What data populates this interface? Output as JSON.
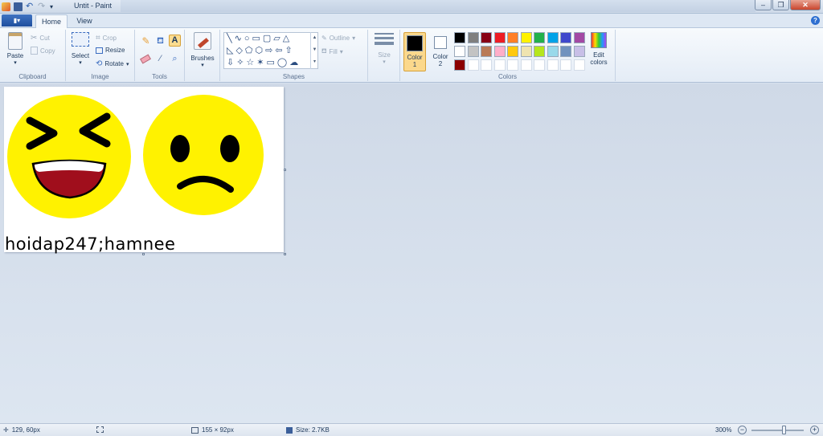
{
  "window": {
    "title": "Untit - Paint"
  },
  "tabs": {
    "file_menu": "▮▾",
    "home": "Home",
    "view": "View"
  },
  "clipboard": {
    "paste": "Paste",
    "cut": "Cut",
    "copy": "Copy",
    "label": "Clipboard"
  },
  "image": {
    "select": "Select",
    "crop": "Crop",
    "resize": "Resize",
    "rotate": "Rotate",
    "label": "Image"
  },
  "tools": {
    "label": "Tools"
  },
  "brushes": {
    "label": "Brushes"
  },
  "shapes": {
    "outline": "Outline",
    "fill": "Fill",
    "label": "Shapes"
  },
  "size": {
    "label": "Size"
  },
  "colors": {
    "color1": "Color\n1",
    "color1_line1": "Color",
    "color1_line2": "1",
    "color2_line1": "Color",
    "color2_line2": "2",
    "edit_line1": "Edit",
    "edit_line2": "colors",
    "label": "Colors",
    "color1_value": "#000000",
    "color2_value": "#ffffff",
    "palette_row1": [
      "#000000",
      "#7f7f7f",
      "#880015",
      "#ed1c24",
      "#ff7f27",
      "#fff200",
      "#22b14c",
      "#00a2e8",
      "#3f48cc",
      "#a349a4"
    ],
    "palette_row2": [
      "#ffffff",
      "#c3c3c3",
      "#b97a57",
      "#ffaec9",
      "#ffc90e",
      "#efe4b0",
      "#b5e61d",
      "#99d9ea",
      "#7092be",
      "#c8bfe7"
    ],
    "palette_row3": [
      "#8b0000",
      "",
      "",
      "",
      "",
      "",
      "",
      "",
      "",
      ""
    ]
  },
  "canvas": {
    "text": "hoidap247;hamnee"
  },
  "status": {
    "cursor": "129, 60px",
    "dimensions": "155 × 92px",
    "size": "Size: 2.7KB",
    "zoom": "300%"
  }
}
